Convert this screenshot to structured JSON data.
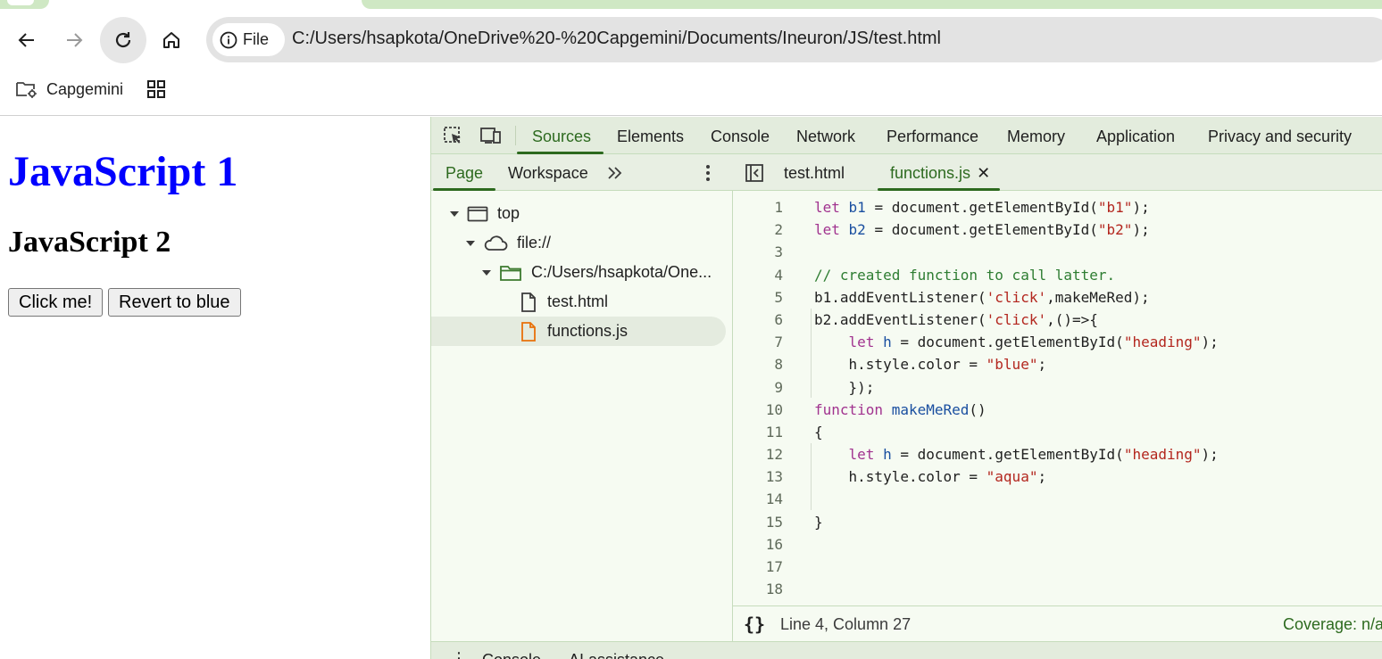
{
  "browser": {
    "address_chip": "File",
    "url": "C:/Users/hsapkota/OneDrive%20-%20Capgemini/Documents/Ineuron/JS/test.html",
    "bookmark": "Capgemini"
  },
  "page": {
    "heading1": "JavaScript 1",
    "heading1_color": "#0000ff",
    "heading2": "JavaScript 2",
    "button1": "Click me!",
    "button2": "Revert to blue"
  },
  "devtools": {
    "tabs": [
      "Sources",
      "Elements",
      "Console",
      "Network",
      "Performance",
      "Memory",
      "Application",
      "Privacy and security"
    ],
    "active_tab": "Sources",
    "navigator": {
      "tabs": [
        "Page",
        "Workspace"
      ],
      "tree": [
        "top",
        "file://",
        "C:/Users/hsapkota/One...",
        "test.html",
        "functions.js"
      ]
    },
    "editor": {
      "tabs": [
        "test.html",
        "functions.js"
      ],
      "active_tab": "functions.js",
      "line_numbers": [
        "1",
        "2",
        "3",
        "4",
        "5",
        "6",
        "7",
        "8",
        "9",
        "10",
        "11",
        "12",
        "13",
        "14",
        "15",
        "16",
        "17",
        "18"
      ]
    },
    "status": {
      "braces": "{}",
      "position": "Line 4, Column 27",
      "coverage": "Coverage: n/a"
    },
    "drawer": [
      "Console",
      "AI assistance"
    ]
  }
}
